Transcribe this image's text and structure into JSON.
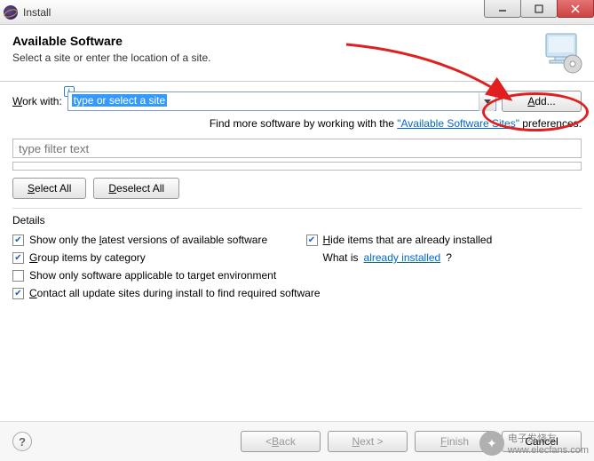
{
  "window": {
    "title": "Install"
  },
  "header": {
    "heading": "Available Software",
    "subtitle": "Select a site or enter the location of a site."
  },
  "workwith": {
    "label": "Work with:",
    "value": "type or select a site",
    "add_btn": "Add..."
  },
  "hint": {
    "prefix": "Find more software by working with the ",
    "link": "\"Available Software Sites\"",
    "suffix": " preferences."
  },
  "filter": {
    "placeholder": "type filter text"
  },
  "buttons": {
    "select_all": "Select All",
    "deselect_all": "Deselect All"
  },
  "details": {
    "label": "Details",
    "cb_latest": "Show only the latest versions of available software",
    "cb_hide": "Hide items that are already installed",
    "cb_group": "Group items by category",
    "whatis_prefix": "What is ",
    "whatis_link": "already installed",
    "whatis_suffix": "?",
    "cb_target": "Show only software applicable to target environment",
    "cb_contact": "Contact all update sites during install to find required software"
  },
  "footer": {
    "back": "< Back",
    "next": "Next >",
    "finish": "Finish",
    "cancel": "Cancel"
  },
  "watermark": {
    "text1": "电子发烧友",
    "text2": "www.elecfans.com"
  }
}
